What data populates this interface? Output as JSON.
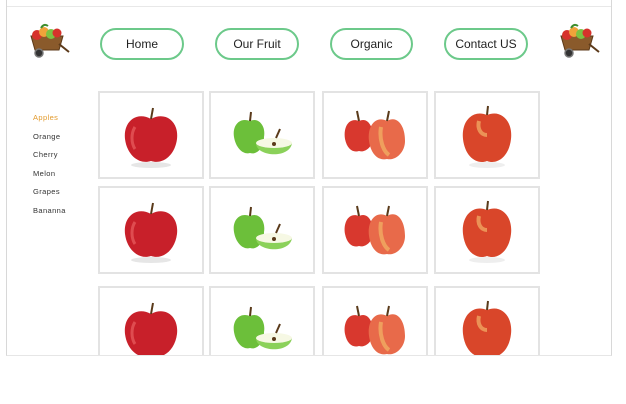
{
  "nav": {
    "items": [
      {
        "label": "Home"
      },
      {
        "label": "Our Fruit"
      },
      {
        "label": "Organic"
      },
      {
        "label": "Contact US"
      }
    ],
    "accent_color": "#6cc98a"
  },
  "sidebar": {
    "items": [
      {
        "label": "Apples",
        "active": true
      },
      {
        "label": "Orange",
        "active": false
      },
      {
        "label": "Cherry",
        "active": false
      },
      {
        "label": "Melon",
        "active": false
      },
      {
        "label": "Grapes",
        "active": false
      },
      {
        "label": "Bananna",
        "active": false
      }
    ],
    "active_color": "#e39b2e"
  },
  "grid": {
    "rows": [
      [
        "red-apple-icon",
        "green-apple-halved-icon",
        "pair-of-red-apples-icon",
        "orange-red-apple-icon"
      ],
      [
        "red-apple-icon",
        "green-apple-halved-icon",
        "pair-of-red-apples-icon",
        "orange-red-apple-icon"
      ],
      [
        "red-apple-icon",
        "green-apple-halved-icon",
        "pair-of-red-apples-icon",
        "orange-red-apple-icon"
      ]
    ]
  },
  "logos": [
    "fruit-cart-logo-icon",
    "fruit-cart-logo-icon"
  ]
}
